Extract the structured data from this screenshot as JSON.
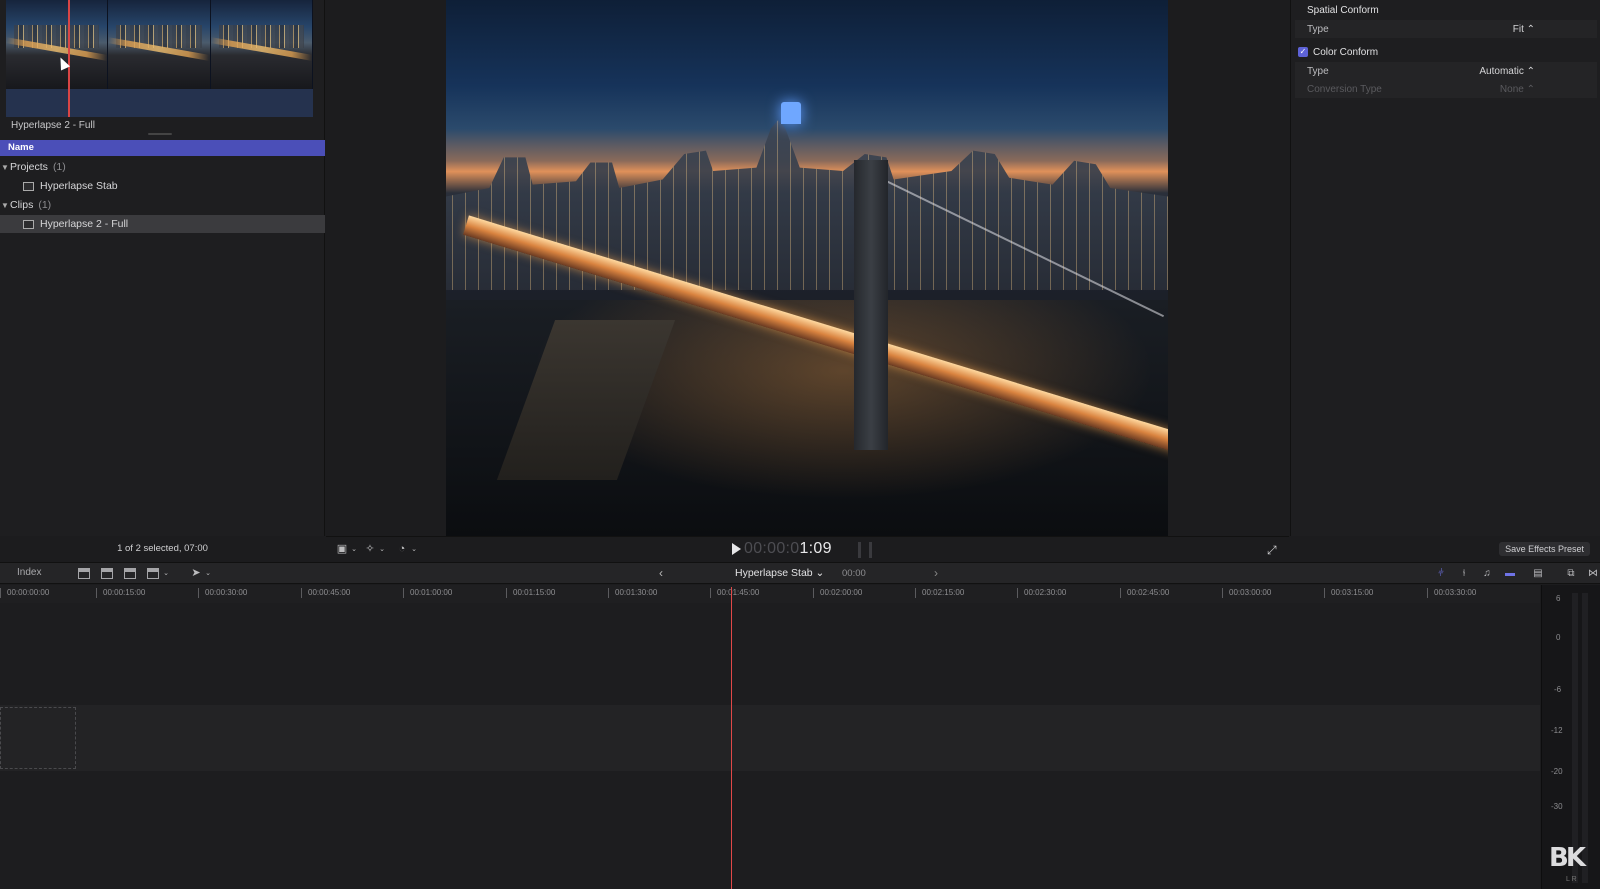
{
  "browser": {
    "clip_caption": "Hyperlapse 2 - Full",
    "column_header": "Name",
    "groups": [
      {
        "label": "Projects",
        "count": "(1)",
        "items": [
          "Hyperlapse Stab"
        ]
      },
      {
        "label": "Clips",
        "count": "(1)",
        "items": [
          "Hyperlapse 2 - Full"
        ]
      }
    ],
    "status": "1 of 2 selected, 07:00"
  },
  "viewer": {
    "timecode_lead": "00:00:0",
    "timecode_tail": "1:09"
  },
  "inspector": {
    "spatial_conform": {
      "heading": "Spatial Conform",
      "type_label": "Type",
      "type_value": "Fit ⌃"
    },
    "color_conform": {
      "heading": "Color Conform",
      "checked": true,
      "type_label": "Type",
      "type_value": "Automatic ⌃",
      "conversion_label": "Conversion Type",
      "conversion_value": "None ⌃"
    },
    "save_preset": "Save Effects Preset"
  },
  "timeline": {
    "index_label": "Index",
    "project_name": "Hyperlapse Stab ⌄",
    "project_duration": "00:00",
    "ruler_ticks": [
      "00:00:00:00",
      "00:00:15:00",
      "00:00:30:00",
      "00:00:45:00",
      "00:01:00:00",
      "00:01:15:00",
      "00:01:30:00",
      "00:01:45:00",
      "00:02:00:00",
      "00:02:15:00",
      "00:02:30:00",
      "00:02:45:00",
      "00:03:00:00",
      "00:03:15:00",
      "00:03:30:00"
    ]
  },
  "meters": {
    "labels": [
      "6",
      "0",
      "-6",
      "-12",
      "-20",
      "-30"
    ],
    "channels": "L R"
  },
  "watermark": "BK",
  "colors": {
    "accent": "#5d62d6",
    "playhead": "#e04848",
    "header": "#4b4fb8"
  }
}
